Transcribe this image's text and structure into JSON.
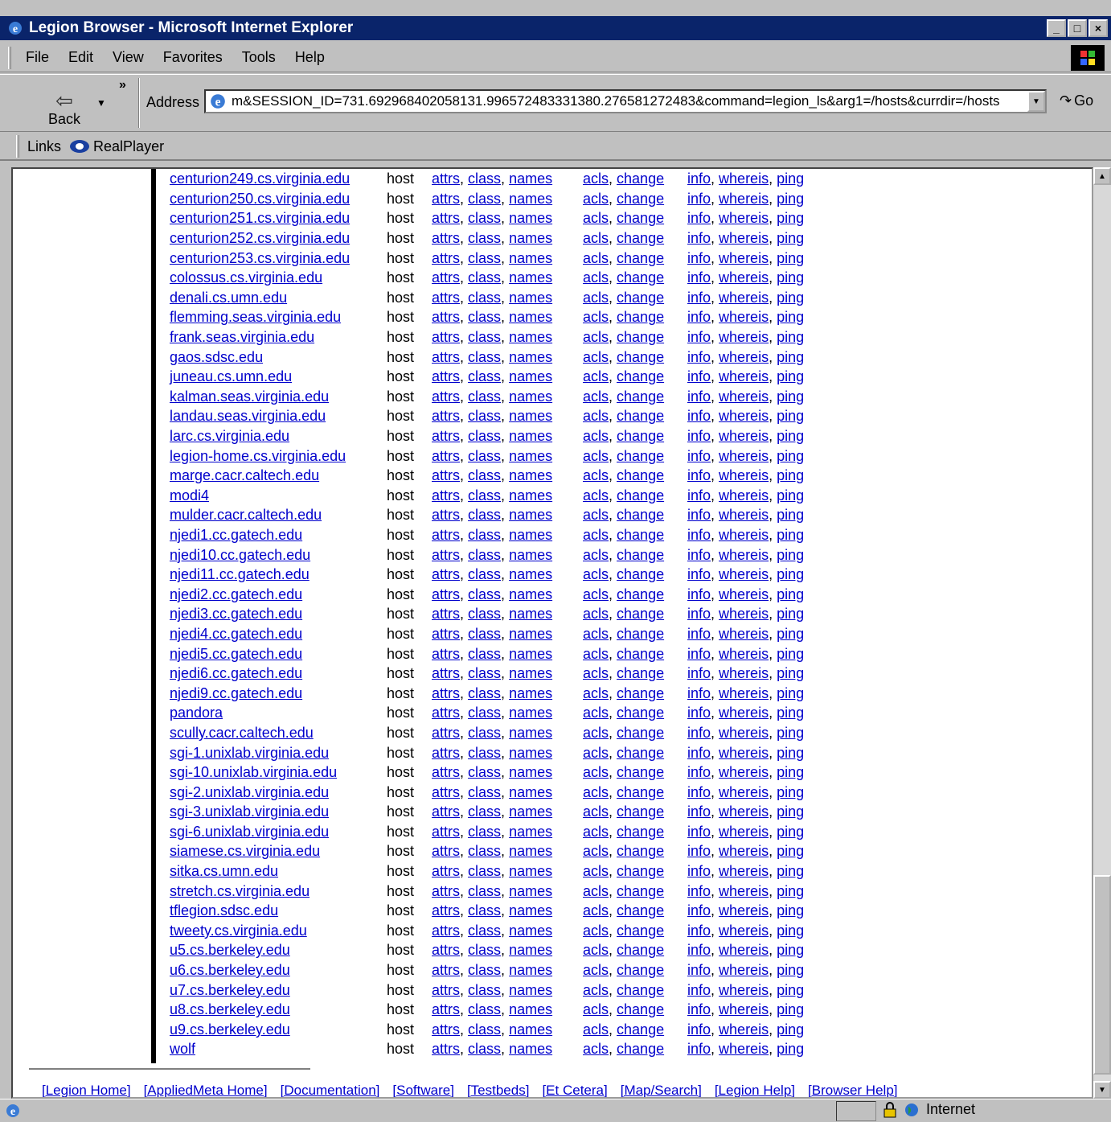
{
  "window": {
    "title": "Legion Browser - Microsoft Internet Explorer",
    "buttons": [
      "_",
      "□",
      "×"
    ]
  },
  "menu": [
    "File",
    "Edit",
    "View",
    "Favorites",
    "Tools",
    "Help"
  ],
  "toolbar": {
    "back_label": "Back",
    "address_label": "Address",
    "address_value": "m&SESSION_ID=731.692968402058131.996572483331380.276581272483&command=legion_ls&arg1=/hosts&currdir=/hosts",
    "go_label": "Go"
  },
  "links_bar": {
    "label": "Links",
    "items": [
      "RealPlayer"
    ]
  },
  "listing": {
    "type_label": "host",
    "actions": [
      "attrs",
      "class",
      "names",
      "acls",
      "change",
      "info",
      "whereis",
      "ping"
    ],
    "hosts": [
      "centurion249.cs.virginia.edu",
      "centurion250.cs.virginia.edu",
      "centurion251.cs.virginia.edu",
      "centurion252.cs.virginia.edu",
      "centurion253.cs.virginia.edu",
      "colossus.cs.virginia.edu",
      "denali.cs.umn.edu",
      "flemming.seas.virginia.edu",
      "frank.seas.virginia.edu",
      "gaos.sdsc.edu",
      "juneau.cs.umn.edu",
      "kalman.seas.virginia.edu",
      "landau.seas.virginia.edu",
      "larc.cs.virginia.edu",
      "legion-home.cs.virginia.edu",
      "marge.cacr.caltech.edu",
      "modi4",
      "mulder.cacr.caltech.edu",
      "njedi1.cc.gatech.edu",
      "njedi10.cc.gatech.edu",
      "njedi11.cc.gatech.edu",
      "njedi2.cc.gatech.edu",
      "njedi3.cc.gatech.edu",
      "njedi4.cc.gatech.edu",
      "njedi5.cc.gatech.edu",
      "njedi6.cc.gatech.edu",
      "njedi9.cc.gatech.edu",
      "pandora",
      "scully.cacr.caltech.edu",
      "sgi-1.unixlab.virginia.edu",
      "sgi-10.unixlab.virginia.edu",
      "sgi-2.unixlab.virginia.edu",
      "sgi-3.unixlab.virginia.edu",
      "sgi-6.unixlab.virginia.edu",
      "siamese.cs.virginia.edu",
      "sitka.cs.umn.edu",
      "stretch.cs.virginia.edu",
      "tflegion.sdsc.edu",
      "tweety.cs.virginia.edu",
      "u5.cs.berkeley.edu",
      "u6.cs.berkeley.edu",
      "u7.cs.berkeley.edu",
      "u8.cs.berkeley.edu",
      "u9.cs.berkeley.edu",
      "wolf"
    ]
  },
  "footer_links": [
    "[Legion Home]",
    "[AppliedMeta Home]",
    "[Documentation]",
    "[Software]",
    "[Testbeds]",
    "[Et Cetera]",
    "[Map/Search]",
    "[Legion Help]",
    "[Browser Help]"
  ],
  "status": {
    "zone": "Internet"
  }
}
